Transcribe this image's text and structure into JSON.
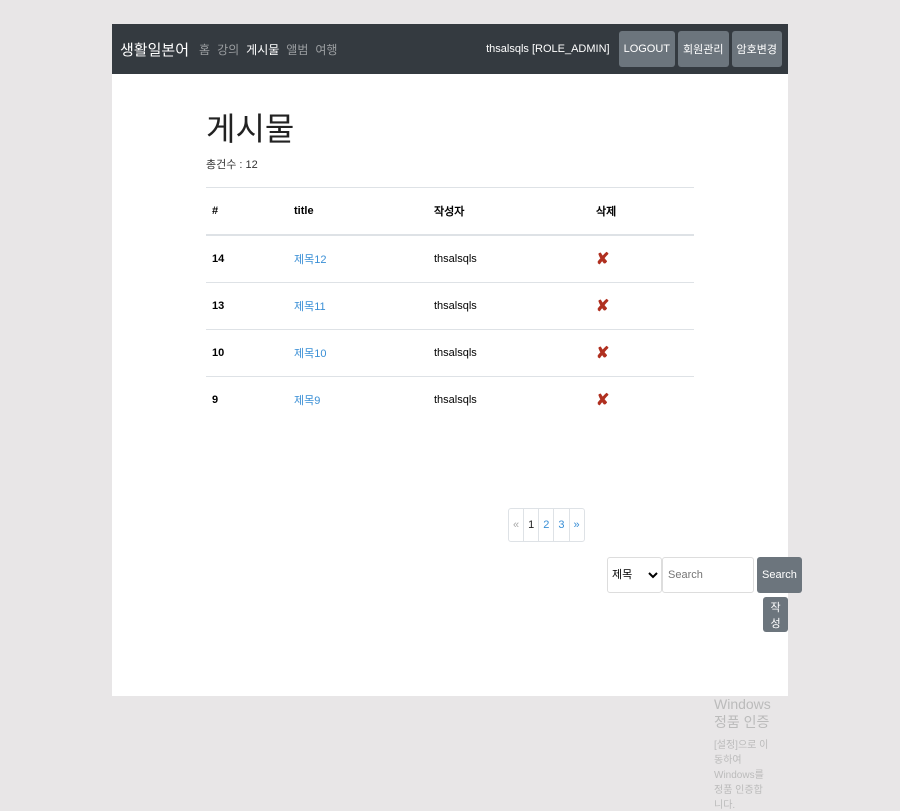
{
  "nav": {
    "brand": "생활일본어",
    "links": [
      "홈",
      "강의",
      "게시물",
      "앨범",
      "여행"
    ],
    "active": 2,
    "user": "thsalsqls [ROLE_ADMIN]",
    "buttons": [
      "LOGOUT",
      "회원관리",
      "암호변경"
    ]
  },
  "page": {
    "title": "게시물",
    "total": "총건수 : 12"
  },
  "table": {
    "headers": [
      "#",
      "title",
      "작성자",
      "삭제"
    ],
    "rows": [
      {
        "num": "14",
        "title": "제목12",
        "author": "thsalsqls"
      },
      {
        "num": "13",
        "title": "제목11",
        "author": "thsalsqls"
      },
      {
        "num": "10",
        "title": "제목10",
        "author": "thsalsqls"
      },
      {
        "num": "9",
        "title": "제목9",
        "author": "thsalsqls"
      }
    ],
    "delete_glyph": "✘"
  },
  "pager": {
    "prev": "«",
    "pages": [
      "1",
      "2",
      "3"
    ],
    "current": "1",
    "next": "»"
  },
  "search": {
    "select_value": "제목",
    "placeholder": "Search",
    "button": "Search",
    "write": "작성"
  },
  "watermark": {
    "line1": "Windows 정품 인증",
    "line2": "[설정]으로 이동하여 Windows를 정품 인증합니다."
  }
}
